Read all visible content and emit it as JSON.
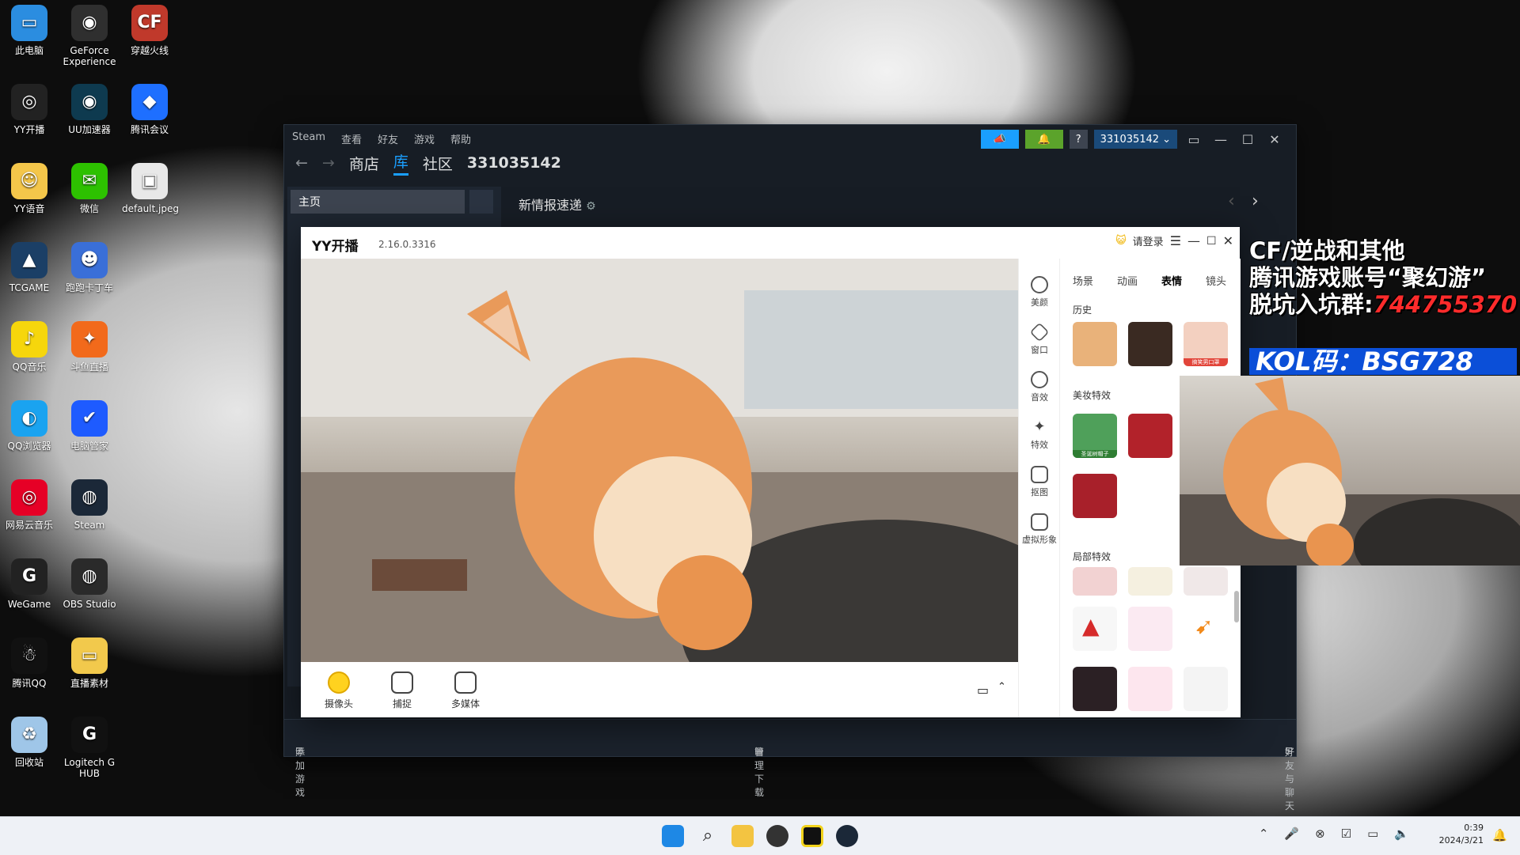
{
  "desktop": {
    "icons": [
      {
        "label": "此电脑",
        "color": "#2b8de0",
        "glyph": "▭"
      },
      {
        "label": "GeForce Experience",
        "color": "#2f2f2f",
        "glyph": "◉"
      },
      {
        "label": "穿越火线",
        "color": "#c0392b",
        "glyph": "CF"
      },
      {
        "label": "YY开播",
        "color": "#222",
        "glyph": "◎"
      },
      {
        "label": "UU加速器",
        "color": "#0e3a4f",
        "glyph": "◉"
      },
      {
        "label": "腾讯会议",
        "color": "#1e6fff",
        "glyph": "◆"
      },
      {
        "label": "YY语音",
        "color": "#f4c64a",
        "glyph": "☺"
      },
      {
        "label": "微信",
        "color": "#2dc100",
        "glyph": "✉"
      },
      {
        "label": "default.jpeg",
        "color": "#e8e8e8",
        "glyph": "▣"
      },
      {
        "label": "TCGAME",
        "color": "#1b3f66",
        "glyph": "▲"
      },
      {
        "label": "跑跑卡丁车",
        "color": "#3a6fd8",
        "glyph": "☻"
      },
      {
        "label": "QQ音乐",
        "color": "#f6d60c",
        "glyph": "♪"
      },
      {
        "label": "斗鱼直播",
        "color": "#f26a1b",
        "glyph": "✦"
      },
      {
        "label": "QQ浏览器",
        "color": "#1aa3f0",
        "glyph": "◐"
      },
      {
        "label": "电脑管家",
        "color": "#1e5bff",
        "glyph": "✔"
      },
      {
        "label": "网易云音乐",
        "color": "#e60026",
        "glyph": "◎"
      },
      {
        "label": "Steam",
        "color": "#1b2838",
        "glyph": "◍"
      },
      {
        "label": "WeGame",
        "color": "#222",
        "glyph": "G"
      },
      {
        "label": "OBS Studio",
        "color": "#2a2a2a",
        "glyph": "◍"
      },
      {
        "label": "腾讯QQ",
        "color": "#111",
        "glyph": "☃"
      },
      {
        "label": "直播素材",
        "color": "#f2c94c",
        "glyph": "▭"
      },
      {
        "label": "回收站",
        "color": "#9fc6e8",
        "glyph": "♻"
      },
      {
        "label": "Logitech G HUB",
        "color": "#111",
        "glyph": "G"
      }
    ]
  },
  "steam": {
    "menu": [
      "Steam",
      "查看",
      "好友",
      "游戏",
      "帮助"
    ],
    "nav": {
      "store": "商店",
      "library": "库",
      "community": "社区",
      "user": "331035142"
    },
    "account": "331035142",
    "home_label": "主页",
    "whats_new": "新情报速递",
    "bottom": {
      "add_game": "添加游戏",
      "manage_downloads": "管理下载",
      "friends_chat": "好友与聊天"
    }
  },
  "yy": {
    "title": "YY开播",
    "version": "2.16.0.3316",
    "login": "请登录",
    "toolbar": [
      {
        "label": "摄像头",
        "icon": "camera-icon"
      },
      {
        "label": "捕捉",
        "icon": "capture-icon"
      },
      {
        "label": "多媒体",
        "icon": "media-icon"
      }
    ],
    "side": [
      {
        "label": "美颜",
        "icon": "beauty-icon"
      },
      {
        "label": "窗口",
        "icon": "layers-icon"
      },
      {
        "label": "音效",
        "icon": "sound-icon"
      },
      {
        "label": "特效",
        "icon": "wand-icon"
      },
      {
        "label": "抠图",
        "icon": "portrait-icon"
      },
      {
        "label": "虚拟形象",
        "icon": "avatar-icon"
      }
    ],
    "tabs": [
      "场景",
      "动画",
      "表情",
      "镜头"
    ],
    "sections": {
      "history": "历史",
      "makeup": "美妆特效",
      "local": "局部特效"
    },
    "thumb_labels": {
      "h3": "搞笑男口罩",
      "m1": "圣诞树帽子"
    }
  },
  "overlay": {
    "line1": "CF/逆战和其他",
    "line2": "腾讯游戏账号“聚幻游”",
    "line3_prefix": "脱坑入坑群:",
    "line3_number": "744755370",
    "kol": "KOL码：BSG728"
  },
  "taskbar": {
    "time": "0:39",
    "date": "2024/3/21"
  },
  "colors": {
    "steam_accent": "#1a9fff",
    "steam_bg": "#171d25",
    "kol_bg": "#0b4fd8",
    "overlay_red": "#ff2b2b"
  }
}
